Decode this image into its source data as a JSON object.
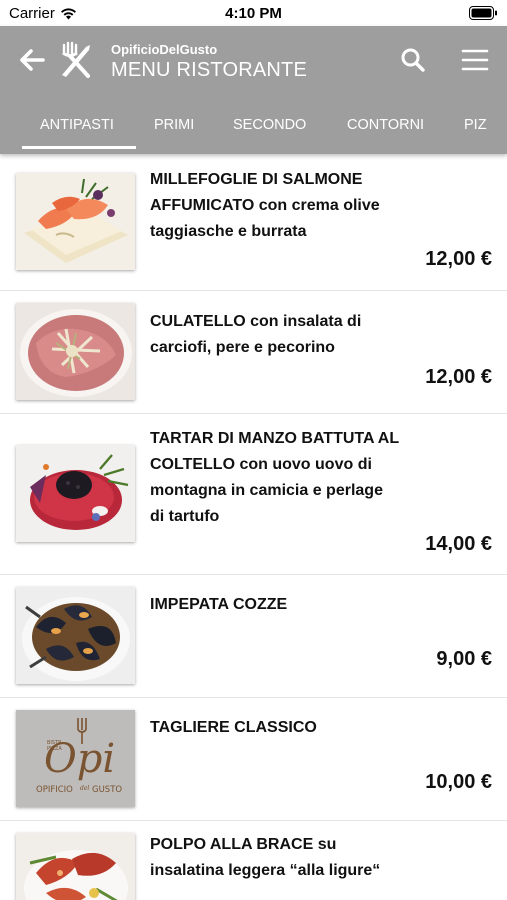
{
  "status_bar": {
    "carrier": "Carrier",
    "time": "4:10 PM"
  },
  "header": {
    "subtitle": "OpificioDelGusto",
    "title": "MENU RISTORANTE"
  },
  "tabs": [
    {
      "label": "ANTIPASTI",
      "active": true
    },
    {
      "label": "PRIMI",
      "active": false
    },
    {
      "label": "SECONDO",
      "active": false
    },
    {
      "label": "CONTORNI",
      "active": false
    },
    {
      "label": "PIZ",
      "active": false
    }
  ],
  "items": [
    {
      "lines": [
        "MILLEFOGLIE DI SALMONE",
        "AFFUMICATO con crema olive",
        "taggiasche e burrata"
      ],
      "price": "12,00 €",
      "image": "salmon-millefoglie-photo"
    },
    {
      "lines": [
        "CULATELLO con insalata di",
        "carciofi, pere e pecorino"
      ],
      "price": "12,00 €",
      "image": "culatello-photo"
    },
    {
      "lines": [
        "TARTAR DI MANZO BATTUTA AL",
        "COLTELLO con uovo uovo di",
        "montagna in camicia e perlage",
        "di tartufo"
      ],
      "price": "14,00 €",
      "image": "tartar-photo"
    },
    {
      "lines": [
        "IMPEPATA COZZE"
      ],
      "price": "9,00 €",
      "image": "mussels-photo"
    },
    {
      "lines": [
        "TAGLIERE CLASSICO"
      ],
      "price": "10,00 €",
      "image": "opificio-logo-placeholder",
      "logo_text": {
        "opi": "Opi",
        "left": "OPIFICIO",
        "mid": "del",
        "right": "GUSTO",
        "small_top": "BISTR",
        "small_bottom": "PIZZA"
      }
    },
    {
      "lines": [
        "POLPO ALLA BRACE su",
        "insalatina leggera “alla ligure“"
      ],
      "price": "",
      "image": "octopus-photo"
    }
  ],
  "colors": {
    "header_bg": "#9e9e9e",
    "header_text": "#ffffff",
    "price_text": "#111111",
    "divider": "#e4e4e4"
  }
}
